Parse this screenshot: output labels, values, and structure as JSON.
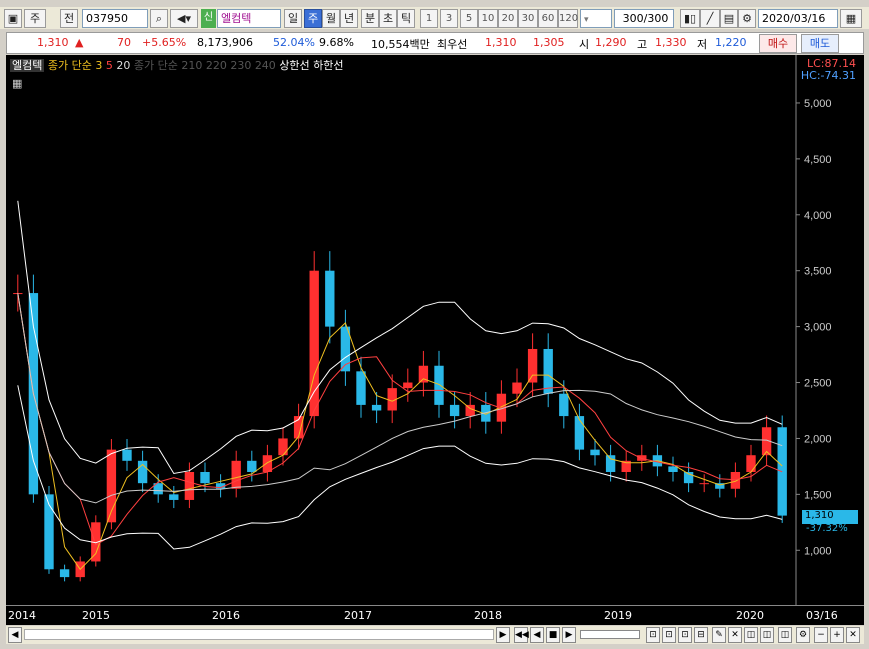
{
  "toolbar": {
    "type_label": "주",
    "kind_label": "전",
    "code": "037950",
    "new_tag": "신",
    "stock_name": "엘컴텍",
    "periods": [
      "일",
      "주",
      "월",
      "년",
      "분",
      "초",
      "틱"
    ],
    "active_period": "주",
    "intervals": [
      "1",
      "3",
      "5",
      "10",
      "20",
      "30",
      "60",
      "120"
    ],
    "count": "300/300",
    "date": "2020/03/16"
  },
  "quote": {
    "price": "1,310",
    "change": "70",
    "change_pct": "+5.65%",
    "volume": "8,173,906",
    "rate1": "52.04%",
    "rate2": "9.68%",
    "amount": "10,554백만",
    "best_label": "최우선",
    "bid1": "1,310",
    "bid2": "1,305",
    "open_label": "시",
    "open": "1,290",
    "high_label": "고",
    "high": "1,330",
    "low_label": "저",
    "low": "1,220",
    "buy_label": "매수",
    "sell_label": "매도"
  },
  "legend": {
    "name": "엘컴텍",
    "ma_short": "종가 단순 3",
    "ma5": "5",
    "ma20": "20",
    "ma_long": "종가 단순 210",
    "extra": "220 230 240",
    "upper": "상한선",
    "lower": "하한선"
  },
  "chart_data": {
    "type": "candlestick",
    "lc_label": "LC:87.14",
    "hc_label": "HC:-74.31",
    "price_tag": "1,310",
    "price_pct": "-37.32%",
    "y_ticks": [
      "5,000",
      "4,500",
      "4,000",
      "3,500",
      "3,000",
      "2,500",
      "2,000",
      "1,500",
      "1,000"
    ],
    "ylim": [
      600,
      5250
    ],
    "x_ticks": [
      "2014",
      "2015",
      "2016",
      "2017",
      "2018",
      "2019",
      "2020",
      "03/16"
    ],
    "series": [
      {
        "name": "close",
        "values": [
          3300,
          1500,
          830,
          760,
          900,
          1250,
          1900,
          1800,
          1600,
          1500,
          1450,
          1700,
          1600,
          1550,
          1800,
          1700,
          1850,
          2000,
          2200,
          3500,
          3000,
          2600,
          2300,
          2250,
          2450,
          2500,
          2650,
          2300,
          2200,
          2300,
          2150,
          2400,
          2500,
          2800,
          2400,
          2200,
          1900,
          1850,
          1700,
          1800,
          1850,
          1750,
          1700,
          1600,
          1600,
          1550,
          1700,
          1850,
          2100,
          1310
        ]
      }
    ]
  }
}
